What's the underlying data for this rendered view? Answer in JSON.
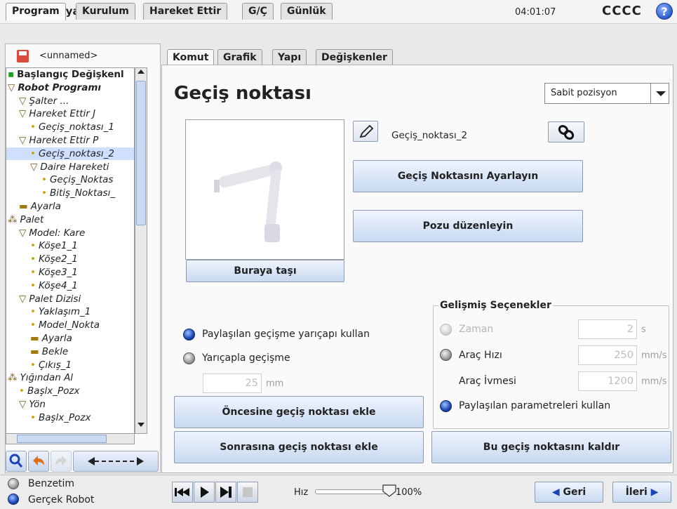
{
  "header": {
    "app_title": "Dosya",
    "clock": "04:01:07",
    "robot_name": "CCCC",
    "help_label": "?"
  },
  "main_tabs": [
    {
      "label": "Program",
      "active": true
    },
    {
      "label": "Kurulum"
    },
    {
      "label": "Hareket Ettir"
    },
    {
      "label": "G/Ç"
    },
    {
      "label": "Günlük"
    }
  ],
  "left": {
    "file_name": "<unnamed>",
    "tree": [
      {
        "label": "Başlangıç Değişkenl",
        "indent": 0,
        "prefix": "▪"
      },
      {
        "label": "Robot Programı",
        "indent": 0,
        "prefix": "▽"
      },
      {
        "label": "Şalter ...",
        "indent": 1,
        "prefix": "▽"
      },
      {
        "label": "Hareket Ettir J",
        "indent": 1,
        "prefix": "▽"
      },
      {
        "label": "Geçiş_noktası_1",
        "indent": 2,
        "prefix": "•"
      },
      {
        "label": "Hareket Ettir P",
        "indent": 1,
        "prefix": "▽"
      },
      {
        "label": "Geçiş_noktası_2",
        "indent": 2,
        "prefix": "•"
      },
      {
        "label": "Daire Hareketi",
        "indent": 2,
        "prefix": "▽"
      },
      {
        "label": "Geçiş_Noktas",
        "indent": 3,
        "prefix": "•"
      },
      {
        "label": "Bitiş_Noktası_",
        "indent": 3,
        "prefix": "•"
      },
      {
        "label": "Ayarla",
        "indent": 1,
        "prefix": "▬"
      },
      {
        "label": "Palet",
        "indent": 0,
        "prefix": "⁂"
      },
      {
        "label": "Model: Kare",
        "indent": 1,
        "prefix": "▽"
      },
      {
        "label": "Köşe1_1",
        "indent": 2,
        "prefix": "•"
      },
      {
        "label": "Köşe2_1",
        "indent": 2,
        "prefix": "•"
      },
      {
        "label": "Köşe3_1",
        "indent": 2,
        "prefix": "•"
      },
      {
        "label": "Köşe4_1",
        "indent": 2,
        "prefix": "•"
      },
      {
        "label": "Palet Dizisi",
        "indent": 1,
        "prefix": "▽"
      },
      {
        "label": "Yaklaşım_1",
        "indent": 2,
        "prefix": "•"
      },
      {
        "label": "Model_Nokta",
        "indent": 2,
        "prefix": "•"
      },
      {
        "label": "Ayarla",
        "indent": 2,
        "prefix": "▬"
      },
      {
        "label": "Bekle",
        "indent": 2,
        "prefix": "▬"
      },
      {
        "label": "Çıkış_1",
        "indent": 2,
        "prefix": "•"
      },
      {
        "label": "Yığından Al",
        "indent": 0,
        "prefix": "⁂"
      },
      {
        "label": "Başlx_Pozx",
        "indent": 1,
        "prefix": "•"
      },
      {
        "label": "Yön",
        "indent": 1,
        "prefix": "▽"
      },
      {
        "label": "Başlx_Pozx",
        "indent": 2,
        "prefix": "•"
      }
    ]
  },
  "sub_tabs": [
    {
      "label": "Komut",
      "active": true
    },
    {
      "label": "Grafik"
    },
    {
      "label": "Yapı"
    },
    {
      "label": "Değişkenler"
    }
  ],
  "main": {
    "title": "Geçiş noktası",
    "position_type": "Sabit pozisyon",
    "waypoint_name": "Geçiş_noktası_2",
    "set_waypoint_btn": "Geçiş Noktasını Ayarlayın",
    "edit_pose_btn": "Pozu düzenleyin",
    "move_here_btn": "Buraya taşı",
    "blend_shared": "Paylaşılan geçişme yarıçapı kullan",
    "blend_radius": "Yarıçapla geçişme",
    "blend_value": "25",
    "blend_unit": "mm",
    "add_before_btn": "Öncesine geçiş noktası ekle",
    "add_after_btn": "Sonrasına geçiş noktası ekle",
    "remove_btn": "Bu geçiş noktasını kaldır"
  },
  "advanced": {
    "title": "Gelişmiş Seçenekler",
    "time_label": "Zaman",
    "time_value": "2",
    "time_unit": "s",
    "tool_speed_label": "Araç Hızı",
    "tool_speed_value": "250",
    "tool_speed_unit": "mm/s",
    "tool_accel_label": "Araç İvmesi",
    "tool_accel_value": "1200",
    "tool_accel_unit": "mm/s",
    "shared_params_label": "Paylaşılan parametreleri kullan"
  },
  "bottom": {
    "simulation": "Benzetim",
    "real_robot": "Gerçek Robot",
    "speed_label": "Hız",
    "speed_value": "100%",
    "speed_fraction": 1.0,
    "back_btn": "Geri",
    "next_btn": "İleri"
  },
  "colors": {
    "accent": "#2553c9",
    "status_green": "#1d8f1d",
    "button_top": "#eef4fd",
    "button_bottom": "#c8d9f0"
  }
}
